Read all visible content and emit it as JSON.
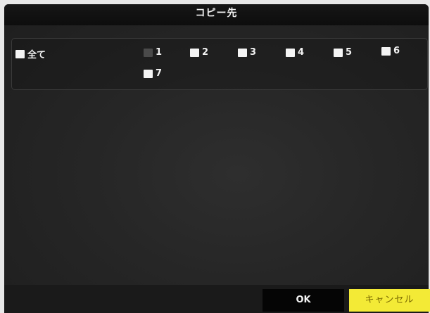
{
  "dialog": {
    "title": "コピー先"
  },
  "channels": {
    "all_label": "全て",
    "items": [
      {
        "label": "1",
        "enabled": false
      },
      {
        "label": "2",
        "enabled": true
      },
      {
        "label": "3",
        "enabled": true
      },
      {
        "label": "4",
        "enabled": true
      },
      {
        "label": "5",
        "enabled": true
      },
      {
        "label": "6",
        "enabled": true
      },
      {
        "label": "7",
        "enabled": true
      }
    ]
  },
  "buttons": {
    "ok_label": "OK",
    "cancel_label": "キャンセル"
  },
  "colors": {
    "cancel_button": "#f3ea36",
    "ok_button": "#050505",
    "checkbox": "#f4f4f4",
    "checkbox_disabled": "#4a4a4a"
  }
}
